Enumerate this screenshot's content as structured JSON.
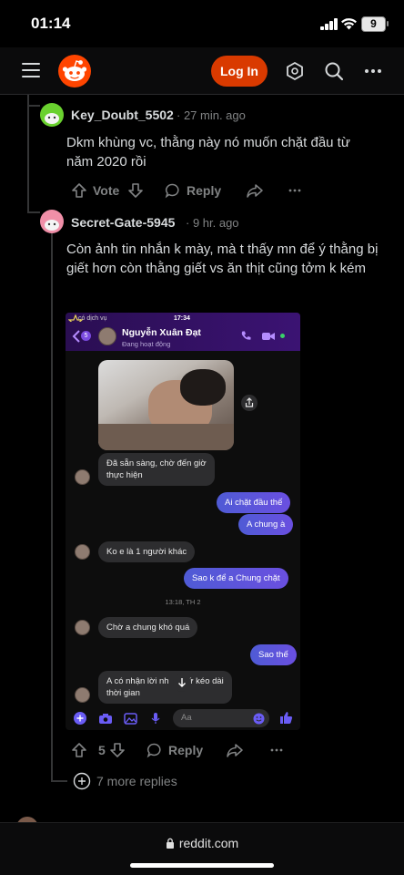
{
  "status_bar": {
    "time": "01:14",
    "battery": "9"
  },
  "header": {
    "login_label": "Log In"
  },
  "comments": [
    {
      "username": "Key_Doubt_5502",
      "age": "· 27 min. ago",
      "body": "Dkm khùng vc, thằng này nó muốn chặt đầu từ năm 2020 rồi",
      "vote_label": "Vote",
      "reply_label": "Reply",
      "avatar_color": "#6ad12f"
    },
    {
      "username": "Secret-Gate-5945",
      "age": "· 9 hr. ago",
      "body": "Còn ảnh tin nhắn k mày, mà t thấy mn để ý thằng bị giết hơn còn thằng giết vs ăn thịt cũng tởm k kém",
      "vote_count": "5",
      "reply_label": "Reply",
      "avatar_color": "#f08fa8"
    }
  ],
  "embed": {
    "carrier": "có dịch vụ",
    "time": "17:34",
    "back_badge": "5",
    "contact_name": "Nguyễn Xuân Đạt",
    "contact_status": "Đang hoạt động",
    "timestamp": "13:18, TH 2",
    "input_placeholder": "Aa",
    "messages": [
      {
        "dir": "in",
        "text1": "Đã sẵn sàng, chờ đến giờ",
        "text2": "thực hiện"
      },
      {
        "dir": "out",
        "text1": "Ai chặt đầu thế"
      },
      {
        "dir": "out",
        "text1": "A chung à"
      },
      {
        "dir": "in",
        "text1": "Ko e là 1 người khác"
      },
      {
        "dir": "out",
        "text1": "Sao k để a Chung chặt"
      },
      {
        "dir": "in",
        "text1": "Chờ a chung khó quá"
      },
      {
        "dir": "out",
        "text1": "Sao thế"
      },
      {
        "dir": "in",
        "text1": "A có nhận lời nh",
        "text1b": "cứ kéo dài",
        "text2": "thời gian"
      }
    ]
  },
  "more_replies": "7 more replies",
  "footer": {
    "url": "reddit.com"
  },
  "colors": {
    "brand": "#ff4500",
    "login": "#d93a00",
    "muted": "#818384"
  }
}
